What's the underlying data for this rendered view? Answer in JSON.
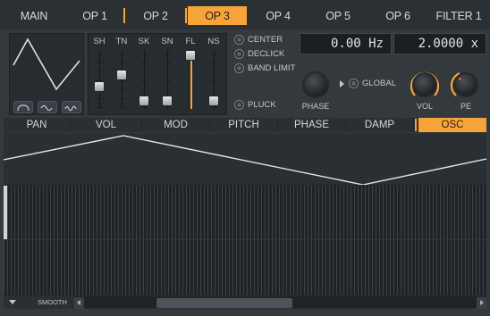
{
  "top_tabs": [
    {
      "label": "MAIN",
      "active": false
    },
    {
      "label": "OP 1",
      "active": false
    },
    {
      "label": "OP 2",
      "active": false
    },
    {
      "label": "OP 3",
      "active": true
    },
    {
      "label": "OP 4",
      "active": false
    },
    {
      "label": "OP 5",
      "active": false
    },
    {
      "label": "OP 6",
      "active": false
    },
    {
      "label": "FILTER 1",
      "active": false
    }
  ],
  "operator": {
    "waveform_icon": "triangle-wave-icon",
    "wave_shape_buttons": [
      "bell-curve-icon",
      "sine-wave-icon",
      "double-sine-icon"
    ],
    "sliders": [
      {
        "label": "SH",
        "level": 0.35
      },
      {
        "label": "TN",
        "level": 0.6
      },
      {
        "label": "SK",
        "level": 0.05
      },
      {
        "label": "SN",
        "level": 0.05
      },
      {
        "label": "FL",
        "level": 1.0
      },
      {
        "label": "NS",
        "level": 0.05
      }
    ],
    "options": {
      "center": "CENTER",
      "declick": "DECLICK",
      "band_limit": "BAND LIMIT",
      "pluck": "PLUCK",
      "global": "GLOBAL"
    },
    "frequency_display": "0.00 Hz",
    "ratio_display": "2.0000 x",
    "knobs": {
      "phase": "PHASE",
      "vol": "VOL",
      "pe": "PE"
    }
  },
  "sub_tabs": [
    {
      "label": "PAN",
      "active": false
    },
    {
      "label": "VOL",
      "active": false
    },
    {
      "label": "MOD",
      "active": false
    },
    {
      "label": "PITCH",
      "active": false
    },
    {
      "label": "PHASE",
      "active": false
    },
    {
      "label": "DAMP",
      "active": false
    },
    {
      "label": "OSC",
      "active": true
    }
  ],
  "bottom": {
    "smooth_label": "SMOOTH"
  },
  "colors": {
    "accent": "#f6a43a",
    "background": "#34393d",
    "panel_dark": "#272c30"
  }
}
